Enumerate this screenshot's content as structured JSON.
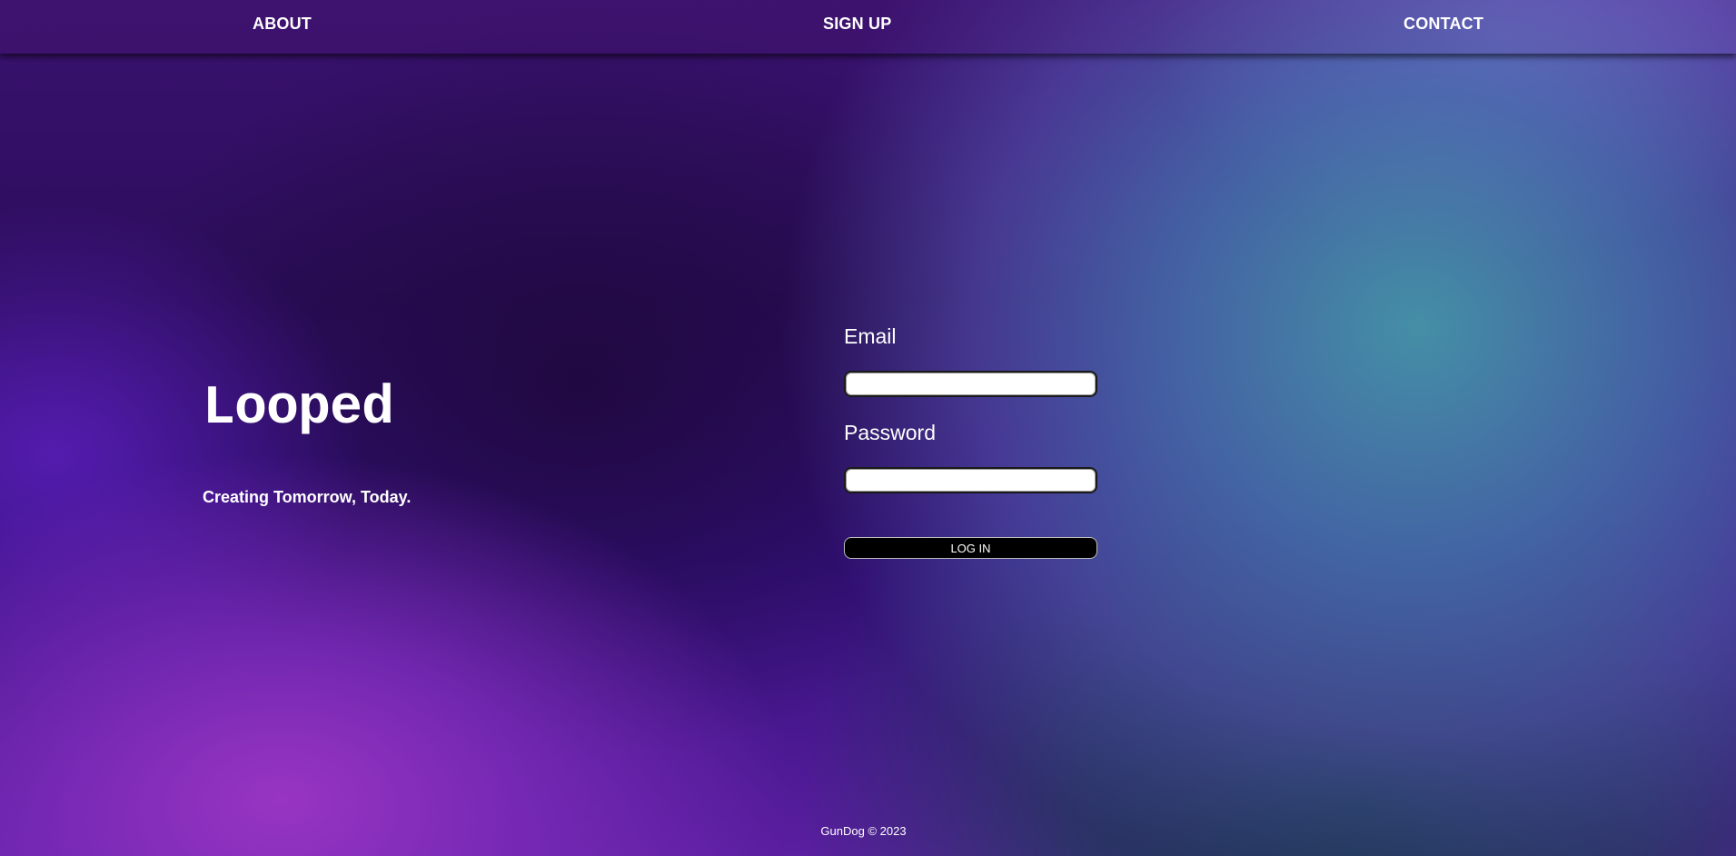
{
  "nav": {
    "about": "ABOUT",
    "signup": "SIGN UP",
    "contact": "CONTACT"
  },
  "hero": {
    "brand": "Looped",
    "tagline": "Creating Tomorrow, Today."
  },
  "login": {
    "email_label": "Email",
    "email_value": "",
    "password_label": "Password",
    "password_value": "",
    "submit_label": "LOG IN"
  },
  "footer": {
    "text": "GunDog © 2023"
  },
  "colors": {
    "text": "#ffffff",
    "button_bg": "#000000",
    "background_dark": "#2a0f57",
    "background_purple": "#9e37c6",
    "background_teal": "#4696aa"
  }
}
